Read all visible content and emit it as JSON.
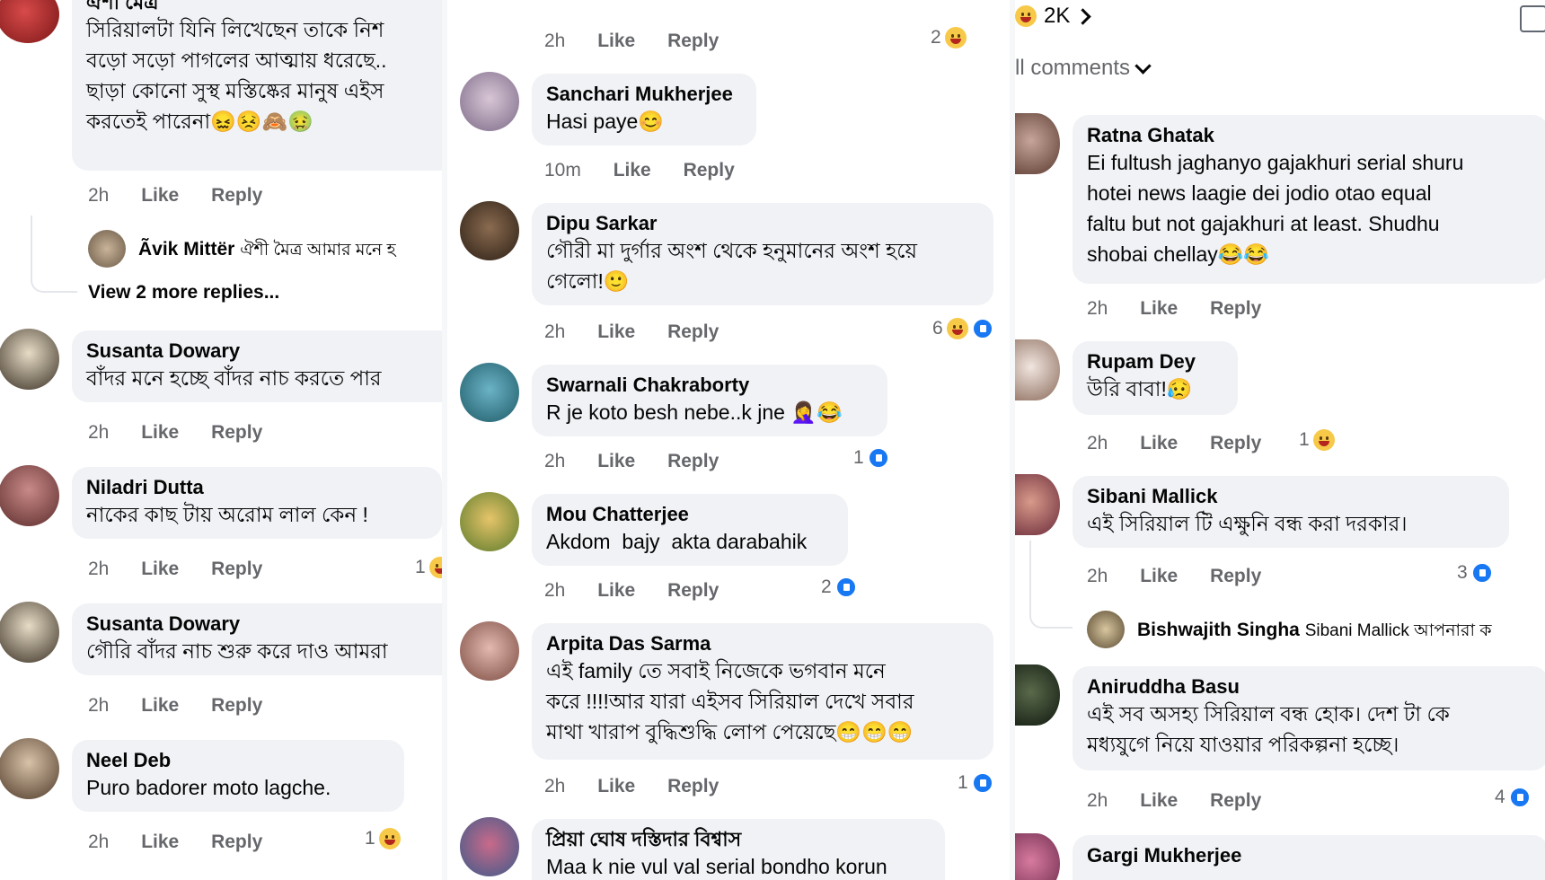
{
  "header": {
    "reaction_count": "2K",
    "filter_label": "ll comments"
  },
  "left": {
    "c1": {
      "name": "ঐশী মৈত্র",
      "text": "সিরিয়ালটা যিনি লিখেছেন তাকে নিশ\nবড়ো সড়ো পাগলের আত্মায় ধরেছে..\nছাড়া কোনো সুস্থ মস্তিষ্কের মানুষ এইস\nকরতেই পারেনা😖😣🙈🤢",
      "time": "2h",
      "like": "Like",
      "reply": "Reply"
    },
    "c1_subreply": {
      "name": "Ãvik Mittër",
      "text": "ঐশী মৈত্র আমার মনে হ"
    },
    "c1_more": "View 2 more replies...",
    "c2": {
      "name": "Susanta Dowary",
      "text": "বাঁদর মনে হচ্ছে বাঁদর নাচ করতে পার",
      "time": "2h",
      "like": "Like",
      "reply": "Reply"
    },
    "c3": {
      "name": "Niladri Dutta",
      "text": "নাকের কাছ টায় অরোম লাল কেন !",
      "time": "2h",
      "like": "Like",
      "reply": "Reply",
      "count": "1"
    },
    "c4": {
      "name": "Susanta Dowary",
      "text": "গৌরি বাঁদর নাচ শুরু করে দাও আমরা",
      "time": "2h",
      "like": "Like",
      "reply": "Reply"
    },
    "c5": {
      "name": "Neel Deb",
      "text": "Puro badorer moto lagche.",
      "time": "2h",
      "like": "Like",
      "reply": "Reply",
      "count": "1"
    }
  },
  "middle": {
    "c0": {
      "time": "2h",
      "like": "Like",
      "reply": "Reply",
      "count": "2"
    },
    "c1": {
      "name": "Sanchari Mukherjee",
      "text": "Hasi paye😊",
      "time": "10m",
      "like": "Like",
      "reply": "Reply"
    },
    "c2": {
      "name": "Dipu Sarkar",
      "text": "গৌরী মা দুর্গার অংশ থেকে হনুমানের অংশ হয়ে\nগেলো!🙂",
      "time": "2h",
      "like": "Like",
      "reply": "Reply",
      "count": "6"
    },
    "c3": {
      "name": "Swarnali Chakraborty",
      "text": "R je koto besh nebe..k jne 🤦‍♀️😂",
      "time": "2h",
      "like": "Like",
      "reply": "Reply",
      "count": "1"
    },
    "c4": {
      "name": "Mou Chatterjee",
      "text": "Akdom  bajy  akta darabahik",
      "time": "2h",
      "like": "Like",
      "reply": "Reply",
      "count": "2"
    },
    "c5": {
      "name": "Arpita Das Sarma",
      "text": "এই family তে সবাই নিজেকে ভগবান মনে\nকরে !!!!আর যারা এইসব সিরিয়াল দেখে সবার\nমাথা খারাপ বুদ্ধিশুদ্ধি লোপ পেয়েছে😁😁😁",
      "time": "2h",
      "like": "Like",
      "reply": "Reply",
      "count": "1"
    },
    "c6": {
      "name": "প্রিয়া ঘোষ দস্তিদার বিশ্বাস",
      "text": "Maa k nie vul val serial bondho korun"
    }
  },
  "right": {
    "c1": {
      "name": "Ratna Ghatak",
      "text": "Ei fultush jaghanyo gajakhuri serial shuru\nhotei news laagie dei jodio otao equal\nfaltu but not gajakhuri at least. Shudhu\nshobai chellay😂😂",
      "time": "2h",
      "like": "Like",
      "reply": "Reply"
    },
    "c2": {
      "name": "Rupam Dey",
      "text": "উরি বাবা!😥",
      "time": "2h",
      "like": "Like",
      "reply": "Reply",
      "count": "1"
    },
    "c3": {
      "name": "Sibani Mallick",
      "text": "এই সিরিয়াল টি এক্ষুনি বন্ধ করা দরকার।",
      "time": "2h",
      "like": "Like",
      "reply": "Reply",
      "count": "3"
    },
    "c3_subreply": {
      "name": "Bishwajith Singha",
      "text": "Sibani Mallick আপনারা ক"
    },
    "c4": {
      "name": "Aniruddha Basu",
      "text": "এই সব অসহ্য সিরিয়াল বন্ধ হোক। দেশ টা কে\nমধ্যযুগে নিয়ে যাওয়ার পরিকল্পনা হচ্ছে।",
      "time": "2h",
      "like": "Like",
      "reply": "Reply",
      "count": "4"
    },
    "c5": {
      "name": "Gargi Mukherjee"
    }
  },
  "colors": {
    "bubble": "#f0f2f5",
    "meta": "#65676b",
    "like_blue": "#1877f2",
    "laugh_yellow": "#f7c948"
  }
}
